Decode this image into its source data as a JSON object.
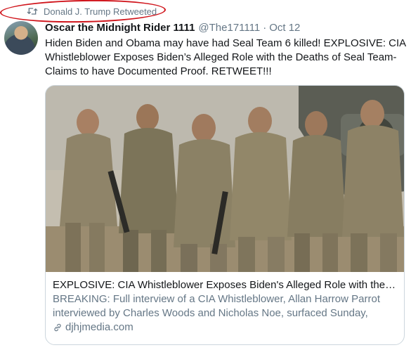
{
  "retweet": {
    "label": "Donald J. Trump Retweeted",
    "icon": "retweet-icon",
    "highlight_color": "#d0141b"
  },
  "tweet": {
    "display_name": "Oscar the Midnight Rider 1111",
    "handle": "@The171111",
    "separator": "·",
    "date": "Oct 12",
    "text": "Hiden Biden and Obama may have had Seal Team 6 killed! EXPLOSIVE: CIA Whistleblower Exposes Biden’s Alleged Role with the Deaths of Seal Team-Claims to have Documented Proof. RETWEET!!!"
  },
  "card": {
    "image_alt": "group-of-soldiers-photo",
    "title": "EXPLOSIVE: CIA Whistleblower Exposes Biden's Alleged Role with the D...",
    "description": "BREAKING: Full interview of a CIA Whistleblower, Allan Harrow Parrot interviewed by Charles Woods and Nicholas Noe, surfaced Sunday, wher...",
    "domain": "djhjmedia.com",
    "domain_icon": "link-icon"
  },
  "colors": {
    "text_primary": "#14171a",
    "text_secondary": "#657786",
    "card_border": "#ccd6dd"
  }
}
